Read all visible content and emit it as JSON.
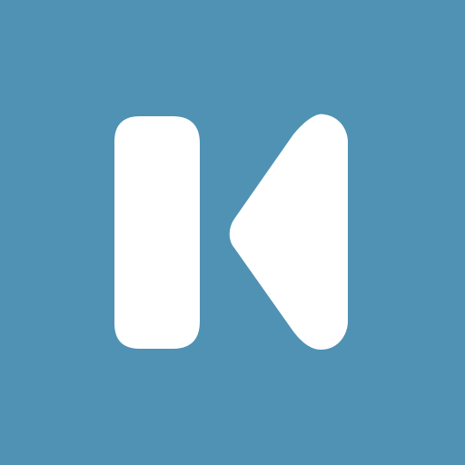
{
  "icon": {
    "name": "skip-back-icon",
    "background_color": "#4F92B4",
    "glyph_color": "#FFFFFF"
  }
}
